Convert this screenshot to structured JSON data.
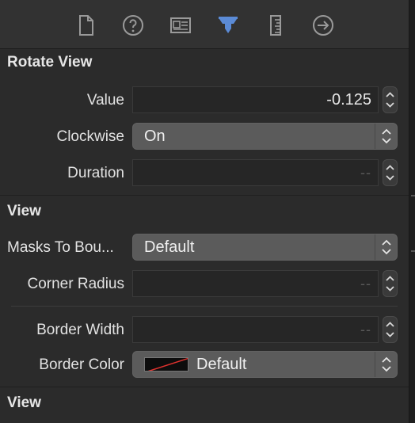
{
  "toolbar": {
    "icons": [
      {
        "name": "file-inspector-icon"
      },
      {
        "name": "quick-help-icon"
      },
      {
        "name": "identity-inspector-icon"
      },
      {
        "name": "attributes-inspector-icon",
        "active": true
      },
      {
        "name": "size-inspector-icon"
      },
      {
        "name": "connections-inspector-icon"
      }
    ],
    "active_color": "#5b8bd6",
    "icon_color": "#9a9a9a"
  },
  "sections": {
    "rotate_view": {
      "title": "Rotate View",
      "value_label": "Value",
      "value": "-0.125",
      "clockwise_label": "Clockwise",
      "clockwise_value": "On",
      "duration_label": "Duration",
      "duration_placeholder": "--"
    },
    "view": {
      "title": "View",
      "masks_label": "Masks To Bou...",
      "masks_value": "Default",
      "corner_radius_label": "Corner Radius",
      "corner_radius_placeholder": "--",
      "border_width_label": "Border Width",
      "border_width_placeholder": "--",
      "border_color_label": "Border Color",
      "border_color_value": "Default"
    },
    "view2": {
      "title": "View"
    }
  }
}
